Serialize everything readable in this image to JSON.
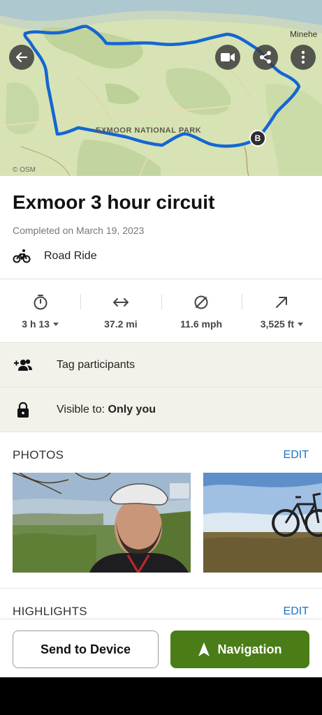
{
  "map": {
    "town_label": "Minehe",
    "park_label": "EXMOOR NATIONAL PARK",
    "osm_credit": "© OSM",
    "end_marker": "B",
    "route_color": "#1466d2"
  },
  "activity": {
    "title": "Exmoor 3 hour circuit",
    "completed": "Completed on March 19, 2023",
    "type": "Road Ride",
    "type_icon": "bike-icon"
  },
  "stats": {
    "duration": "3 h 13",
    "distance": "37.2 mi",
    "avg_speed": "11.6 mph",
    "elevation": "3,525 ft"
  },
  "participants": {
    "label": "Tag participants"
  },
  "visibility": {
    "label": "Visible to:",
    "value": "Only you"
  },
  "photos": {
    "title": "PHOTOS",
    "edit": "EDIT"
  },
  "highlights": {
    "title": "HIGHLIGHTS",
    "edit": "EDIT"
  },
  "actions": {
    "send": "Send to Device",
    "navigate": "Navigation",
    "accent": "#4a7d17"
  }
}
